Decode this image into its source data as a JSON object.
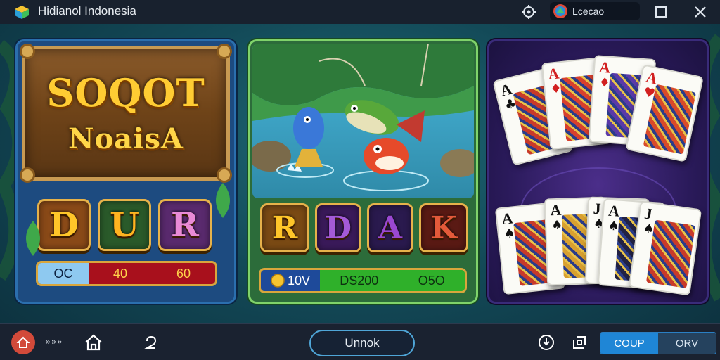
{
  "window": {
    "title": "Hidianol Indonesia",
    "account_label": "Lcecao"
  },
  "panels": {
    "slot": {
      "banner_line1": "SOQOT",
      "banner_line2": "NoaisA",
      "tiles": [
        {
          "letter": "D",
          "color": "#ffc629"
        },
        {
          "letter": "U",
          "color": "#ffb320"
        },
        {
          "letter": "R",
          "color": "#e98ad6"
        }
      ],
      "progress": {
        "left": "OC",
        "mid": "40",
        "right": "60"
      }
    },
    "fishing": {
      "tiles": [
        {
          "letter": "R",
          "color": "#ffc629"
        },
        {
          "letter": "D",
          "color": "#a45ad8"
        },
        {
          "letter": "A",
          "color": "#9a48d2"
        },
        {
          "letter": "K",
          "color": "#e35a3a"
        }
      ],
      "progress": {
        "left": "10V",
        "mid": "DS200",
        "right": "O5O"
      }
    },
    "cards": {
      "top_cards": [
        {
          "rank": "A",
          "suit": "♣",
          "suit_color": "#111111"
        },
        {
          "rank": "A",
          "suit": "♦",
          "suit_color": "#d22020"
        },
        {
          "rank": "A",
          "suit": "♦",
          "suit_color": "#d22020"
        },
        {
          "rank": "A",
          "suit": "♥",
          "suit_color": "#d22020"
        }
      ],
      "bottom_cards": [
        {
          "rank": "A",
          "suit": "♠",
          "suit_color": "#111111"
        },
        {
          "rank": "A",
          "suit": "♠",
          "suit_color": "#111111"
        },
        {
          "rank": "J",
          "suit": "♠",
          "suit_color": "#111111"
        },
        {
          "rank": "A",
          "suit": "♠",
          "suit_color": "#111111"
        },
        {
          "rank": "J",
          "suit": "♠",
          "suit_color": "#111111"
        }
      ]
    }
  },
  "bottom_bar": {
    "dots_label": "»»»",
    "center_button": "Unnok",
    "segment_left": "COUP",
    "segment_right": "ORV"
  }
}
